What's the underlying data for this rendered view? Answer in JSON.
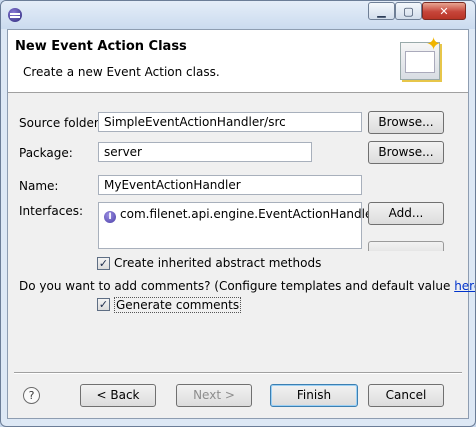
{
  "window": {
    "controls": {
      "minimize": "▁",
      "maximize": "▢",
      "close": "✕"
    }
  },
  "banner": {
    "title": "New Event Action Class",
    "description": "Create a new Event Action class."
  },
  "form": {
    "source_folder": {
      "label": "Source folder:",
      "value": "SimpleEventActionHandler/src",
      "browse": "Browse..."
    },
    "package": {
      "label": "Package:",
      "value": "server",
      "browse": "Browse..."
    },
    "name": {
      "label": "Name:",
      "value": "MyEventActionHandler"
    },
    "interfaces": {
      "label": "Interfaces:",
      "items": [
        "com.filenet.api.engine.EventActionHandler"
      ],
      "add": "Add..."
    },
    "inherited_methods": {
      "label": "Create inherited abstract methods",
      "checked": true
    },
    "comments_prompt": {
      "text": "Do you want to add comments? (Configure templates and default value ",
      "link": "here",
      "suffix": ")"
    },
    "generate_comments": {
      "label": "Generate comments",
      "checked": true
    }
  },
  "footer": {
    "help": "?",
    "back": "< Back",
    "next": "Next >",
    "finish": "Finish",
    "cancel": "Cancel"
  },
  "colors": {
    "link": "#0033cc",
    "default_button_border": "#3c7fb1"
  }
}
